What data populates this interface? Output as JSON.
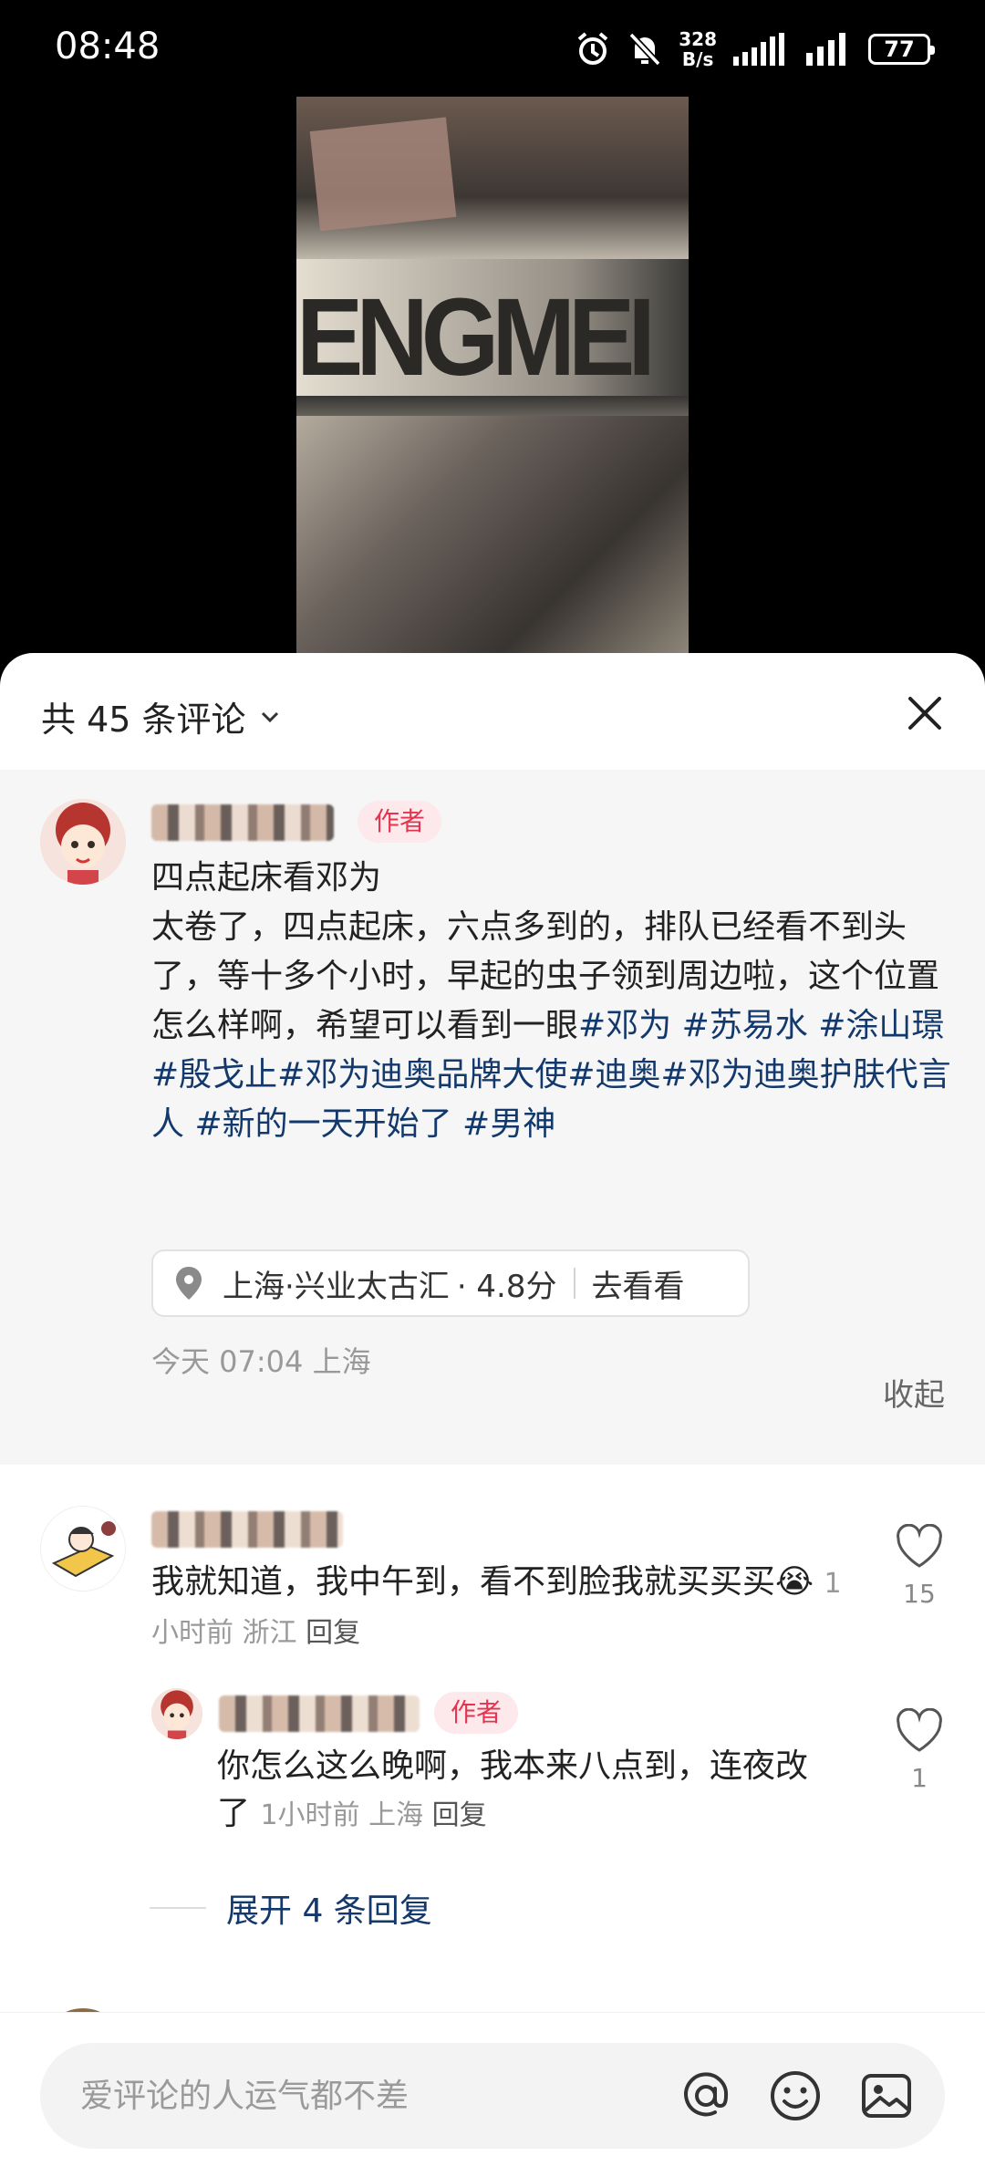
{
  "status_bar": {
    "time": "08:48",
    "net_speed_value": "328",
    "net_speed_unit": "B/s",
    "battery": "77",
    "icons": [
      "alarm-icon",
      "mute-bell-icon",
      "signal-icon",
      "signal-icon",
      "battery-icon"
    ]
  },
  "sheet": {
    "count_label": "共 45 条评论",
    "close_icon": "close-icon"
  },
  "post": {
    "author_tag": "作者",
    "title": "四点起床看邓为",
    "body": "太卷了，四点起床，六点多到的，排队已经看不到头了，等十多个小时，早起的虫子领到周边啦，这个位置怎么样啊，希望可以看到一眼",
    "hashtags": "#邓为 #苏易水 #涂山璟 #殷戈止#邓为迪奥品牌大使#迪奥#邓为迪奥护肤代言人 #新的一天开始了 #男神",
    "location": {
      "name": "上海·兴业太古汇",
      "rating": "· 4.8分",
      "action": "去看看"
    },
    "meta": "今天 07:04 上海",
    "collapse_label": "收起"
  },
  "comments": [
    {
      "text": "我就知道，我中午到，看不到脸我就买买买",
      "emoji": "😭",
      "time": "1小时前",
      "region": "浙江",
      "reply_label": "回复",
      "likes": "15",
      "replies": [
        {
          "author_tag": "作者",
          "text": "你怎么这么晚啊，我本来八点到，连夜改了",
          "time": "1小时前",
          "region": "上海",
          "reply_label": "回复",
          "likes": "1"
        }
      ],
      "expand_label": "展开 4 条回复"
    }
  ],
  "input": {
    "placeholder": "爱评论的人运气都不差",
    "icons": [
      "at-icon",
      "emoji-icon",
      "image-icon"
    ]
  },
  "colors": {
    "hashtag": "#13386c",
    "author_tag_bg": "#fde8ec",
    "author_tag_text": "#e3354f",
    "sheet_bg": "#ffffff",
    "expanded_bg": "#f6f6f6"
  }
}
